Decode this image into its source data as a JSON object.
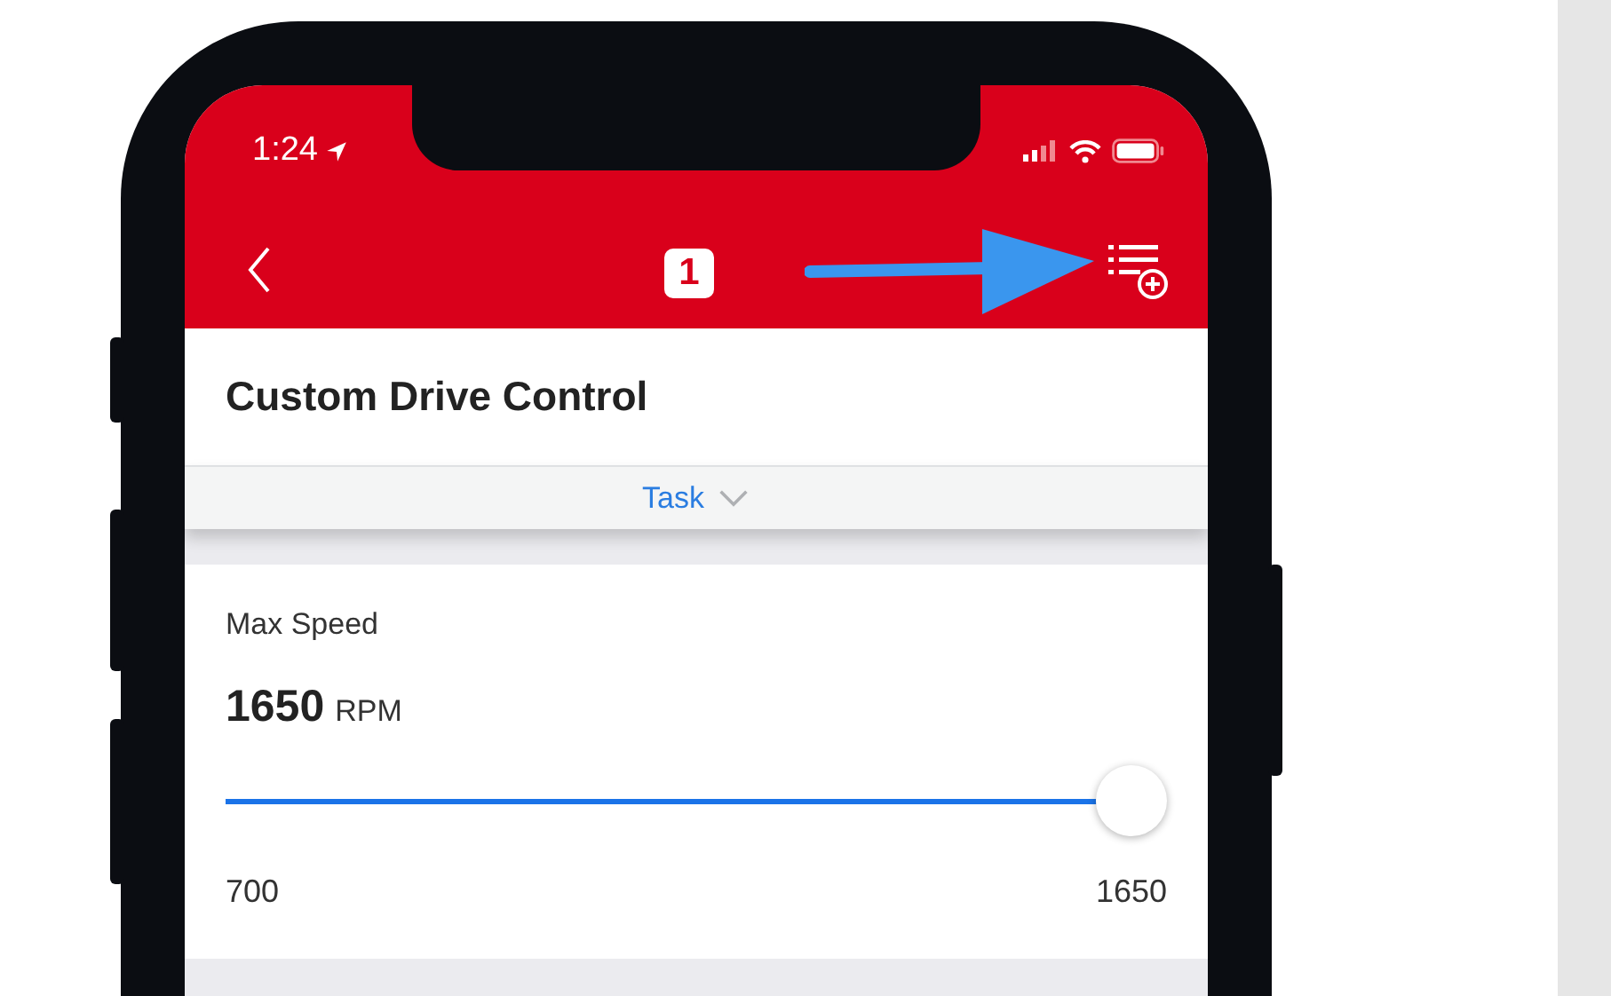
{
  "status_bar": {
    "time": "1:24"
  },
  "nav_bar": {
    "badge": "1"
  },
  "header": {
    "title": "Custom Drive Control"
  },
  "selector": {
    "label": "Task",
    "expanded": false
  },
  "card": {
    "label": "Max Speed",
    "value": "1650",
    "unit": "RPM",
    "slider": {
      "level": 1,
      "min_label": "700",
      "max_label": "1650"
    }
  }
}
